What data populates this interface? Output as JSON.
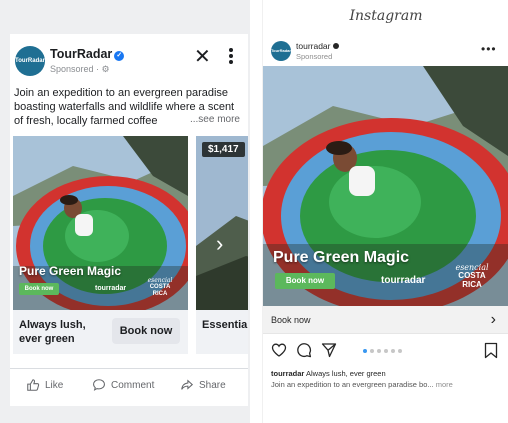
{
  "facebook": {
    "brand": "TourRadar",
    "avatar_text": "TourRadar",
    "sponsored": "Sponsored · ⚙",
    "verified_glyph": "✓",
    "close_glyph": "✕",
    "body": "Join an expedition to an evergreen paradise boasting waterfalls and wildlife where a scent of fresh, locally farmed coffee",
    "see_more": "...see more",
    "carousel": [
      {
        "headline": "Always lush, ever green",
        "cta": "Book now",
        "overlay_title": "Pure Green Magic",
        "overlay_button": "Book now",
        "overlay_logo": "tourradar",
        "overlay_country_script": "esencial",
        "overlay_country": "COSTA RICA"
      },
      {
        "headline": "Essential Costa Rica - F",
        "cta": "",
        "price": "$1,417"
      }
    ],
    "next_glyph": "›",
    "actions": {
      "like": "Like",
      "comment": "Comment",
      "share": "Share"
    }
  },
  "instagram": {
    "title": "Instagram",
    "brand": "tourradar",
    "avatar_text": "TourRadar",
    "sponsored": "Sponsored",
    "more_glyph": "•••",
    "overlay_title": "Pure Green Magic",
    "overlay_button": "Book now",
    "overlay_logo": "tourradar",
    "overlay_country_script": "esencial",
    "overlay_country": "COSTA RICA",
    "cta_label": "Book now",
    "cta_arrow": "›",
    "carousel_pages": 6,
    "carousel_active": 1,
    "caption_user": "tourradar",
    "caption_text": "Always lush, ever green",
    "caption_body": "Join an expedition to an evergreen paradise bo...",
    "caption_more": "more"
  },
  "colors": {
    "fb_blue": "#1877f2",
    "cta_green": "#5cb85c",
    "dress_green": "#2e9a44",
    "dress_red": "#d2332f",
    "dress_blue": "#5a9fd6",
    "ig_pager_active": "#3897f0"
  }
}
